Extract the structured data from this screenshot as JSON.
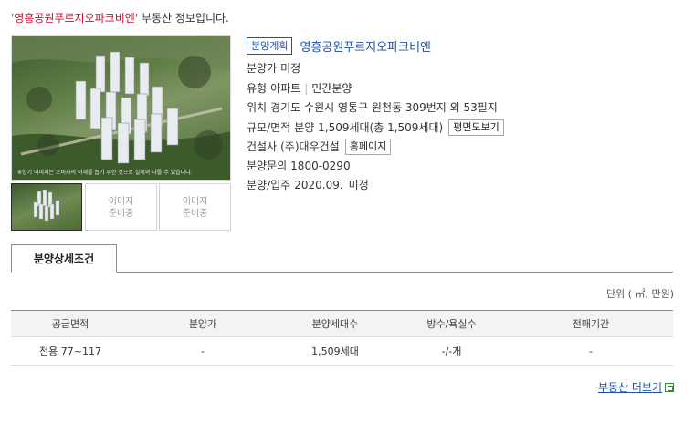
{
  "header": {
    "name": "'영흥공원푸르지오파크비엔'",
    "suffix": " 부동산 정보입니다."
  },
  "photo": {
    "caption": "※상기 이미지는 소비자의 이해를 돕기 위한 것으로 실제와 다를 수 있습니다."
  },
  "thumbs": [
    {
      "placeholder": ""
    },
    {
      "placeholder": "이미지\n준비중"
    },
    {
      "placeholder": "이미지\n준비중"
    }
  ],
  "info": {
    "badge": "분양계획",
    "title": "영흥공원푸르지오파크비엔",
    "price_label": "분양가",
    "price_value": "미정",
    "type_label": "유형",
    "type_value": "아파트",
    "type_value2": "민간분양",
    "loc_label": "위치",
    "loc_value": "경기도 수원시 영통구 원천동 309번지 외 53필지",
    "scale_label": "규모/면적",
    "scale_value": "분양 1,509세대(총 1,509세대)",
    "floorplan_btn": "평면도보기",
    "builder_label": "건설사",
    "builder_value": "(주)대우건설",
    "homepage_btn": "홈페이지",
    "inquiry_label": "분양문의",
    "inquiry_value": "1800-0290",
    "move_label": "분양/입주",
    "move_value": "2020.09.",
    "move_value2": "미정"
  },
  "tab": {
    "label": "분양상세조건"
  },
  "unit": "단위 ( ㎡, 만원)",
  "table": {
    "headers": [
      "공급면적",
      "분양가",
      "분양세대수",
      "방수/욕실수",
      "전매기간"
    ],
    "rows": [
      [
        "전용 77~117",
        "-",
        "1,509세대",
        "-/-개",
        "-"
      ]
    ]
  },
  "more": {
    "label": "부동산 더보기"
  }
}
